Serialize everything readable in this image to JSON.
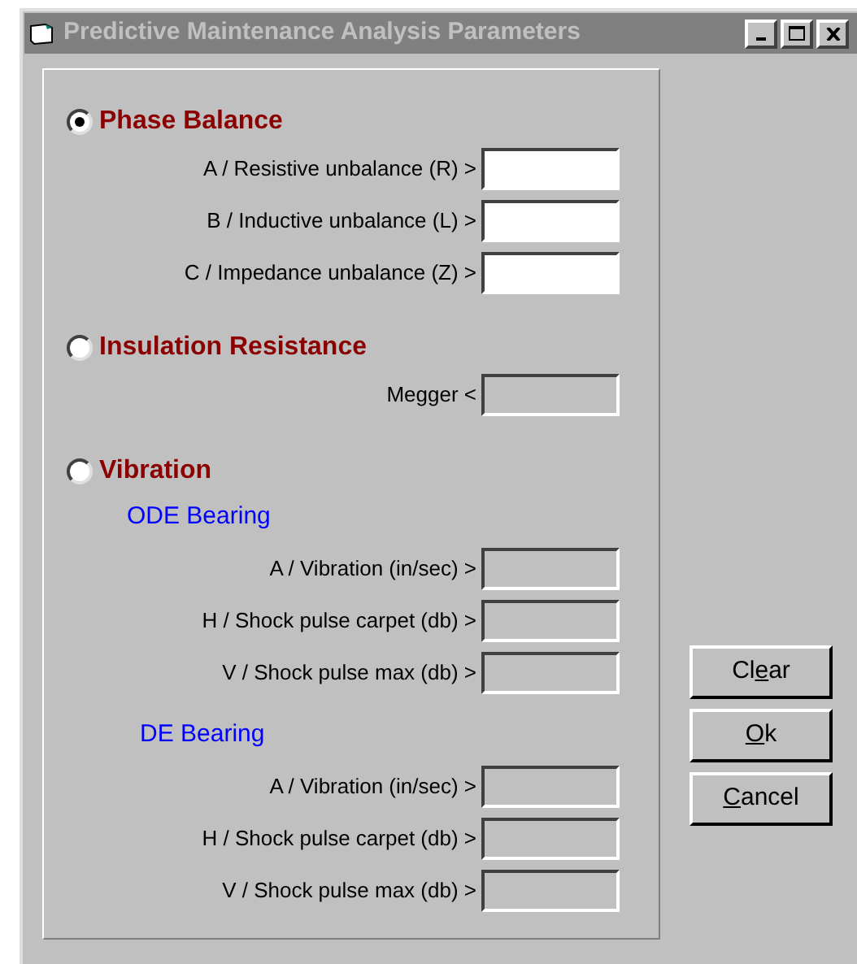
{
  "window": {
    "title": "Predictive Maintenance Analysis Parameters"
  },
  "sections": [
    {
      "label": "Phase Balance",
      "selected": true,
      "groups": [
        {
          "fields": [
            {
              "label": "A / Resistive unbalance (R) >",
              "disabled": false
            },
            {
              "label": "B / Inductive unbalance (L) >",
              "disabled": false
            },
            {
              "label": "C / Impedance unbalance (Z) >",
              "disabled": false
            }
          ]
        }
      ]
    },
    {
      "label": "Insulation Resistance",
      "selected": false,
      "groups": [
        {
          "fields": [
            {
              "label": "Megger <",
              "disabled": true
            }
          ]
        }
      ]
    },
    {
      "label": "Vibration",
      "selected": false,
      "groups": [
        {
          "title": "ODE Bearing",
          "fields": [
            {
              "label": "A / Vibration (in/sec) >",
              "disabled": true
            },
            {
              "label": "H / Shock pulse carpet (db) >",
              "disabled": true
            },
            {
              "label": "V / Shock pulse max (db) >",
              "disabled": true
            }
          ]
        },
        {
          "title": "DE Bearing",
          "fields": [
            {
              "label": "A / Vibration (in/sec) >",
              "disabled": true
            },
            {
              "label": "H / Shock pulse carpet (db) >",
              "disabled": true
            },
            {
              "label": "V / Shock pulse max (db) >",
              "disabled": true
            }
          ]
        }
      ]
    }
  ],
  "buttons": [
    {
      "before": "Cl",
      "key": "e",
      "after": "ar"
    },
    {
      "key": "O",
      "after": "k"
    },
    {
      "key": "C",
      "after": "ancel"
    }
  ]
}
